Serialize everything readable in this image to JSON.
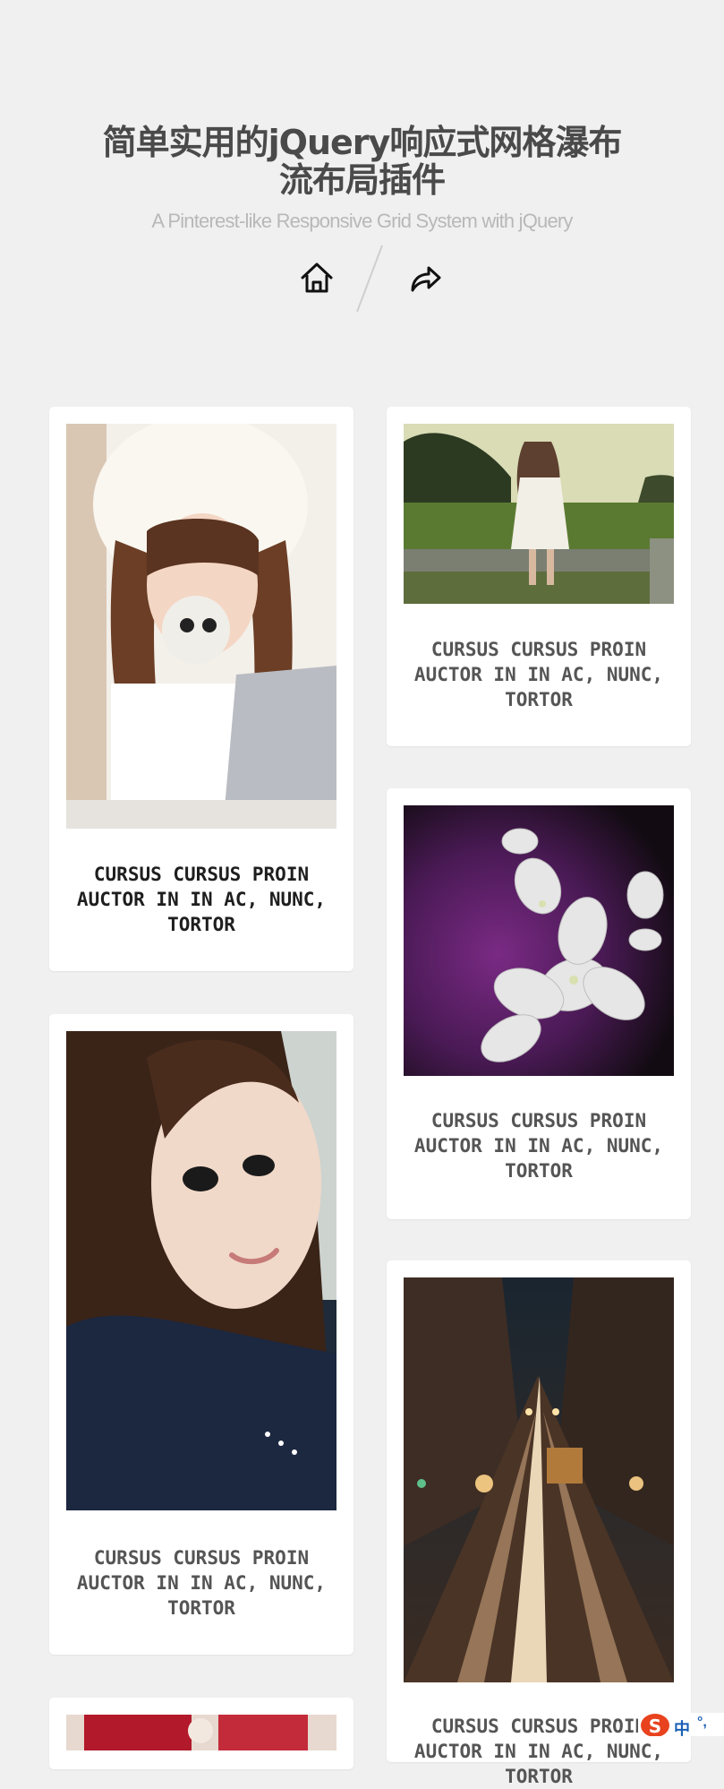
{
  "header": {
    "title": "简单实用的jQuery响应式网格瀑布流布局插件",
    "subtitle": "A Pinterest-like Responsive Grid System with jQuery"
  },
  "nav": {
    "home_icon": "home-icon",
    "share_icon": "share-arrow-icon"
  },
  "cards": [
    {
      "caption": "CURSUS CURSUS PROIN AUCTOR IN IN AC, NUNC, TORTOR",
      "image": "girl-white-fur-hat-photo"
    },
    {
      "caption": "CURSUS CURSUS PROIN AUCTOR IN IN AC, NUNC, TORTOR",
      "image": "girl-sitting-on-wall-photo"
    },
    {
      "caption": "CURSUS CURSUS PROIN AUCTOR IN IN AC, NUNC, TORTOR",
      "image": "white-flowers-purple-photo"
    },
    {
      "caption": "CURSUS CURSUS PROIN AUCTOR IN IN AC, NUNC, TORTOR",
      "image": "girl-long-hair-selfie-photo"
    },
    {
      "caption": "CURSUS CURSUS PROIN AUCTOR IN IN AC, NUNC, TORTOR",
      "image": "city-street-tram-night-photo"
    },
    {
      "caption": "",
      "image": "red-image-partial"
    }
  ],
  "ime": {
    "label": "中",
    "dots": "°,"
  },
  "colors": {
    "background": "#f0f0f0",
    "card": "#ffffff",
    "title": "#4a4a4a",
    "subtitle": "#b8b8b8",
    "ime": "#1a5fb4",
    "ime_logo": "#e8431e"
  }
}
